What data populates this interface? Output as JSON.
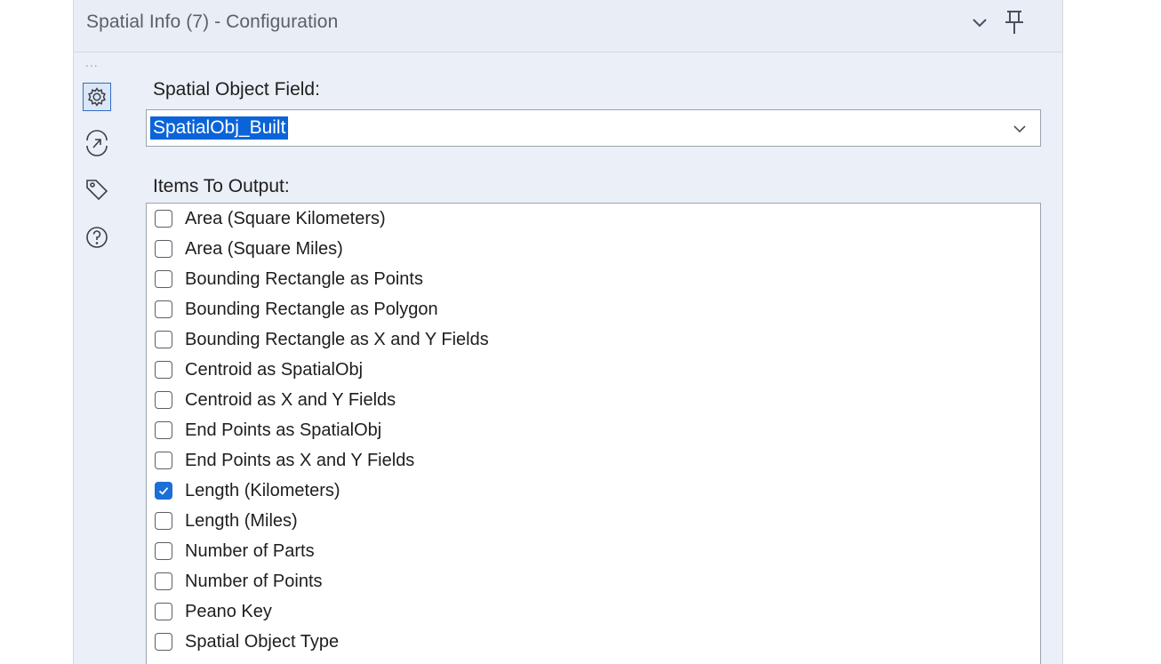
{
  "header": {
    "title": "Spatial Info (7) - Configuration",
    "collapse_icon": "chevron-down-icon",
    "pin_icon": "pin-icon"
  },
  "sidebar": {
    "more_glyph": "...",
    "items": [
      {
        "icon": "gear-icon",
        "active": true
      },
      {
        "icon": "connection-icon",
        "active": false
      },
      {
        "icon": "tag-icon",
        "active": false
      },
      {
        "icon": "help-icon",
        "active": false
      }
    ]
  },
  "spatial_field": {
    "label": "Spatial Object Field:",
    "selected": "SpatialObj_Built"
  },
  "items_output": {
    "label": "Items To Output:",
    "items": [
      {
        "label": "Area (Square Kilometers)",
        "checked": false
      },
      {
        "label": "Area (Square Miles)",
        "checked": false
      },
      {
        "label": "Bounding Rectangle as Points",
        "checked": false
      },
      {
        "label": "Bounding Rectangle as Polygon",
        "checked": false
      },
      {
        "label": "Bounding Rectangle as X and Y Fields",
        "checked": false
      },
      {
        "label": "Centroid as SpatialObj",
        "checked": false
      },
      {
        "label": "Centroid as X and Y Fields",
        "checked": false
      },
      {
        "label": "End Points as SpatialObj",
        "checked": false
      },
      {
        "label": "End Points as X and Y Fields",
        "checked": false
      },
      {
        "label": "Length (Kilometers)",
        "checked": true
      },
      {
        "label": "Length (Miles)",
        "checked": false
      },
      {
        "label": "Number of Parts",
        "checked": false
      },
      {
        "label": "Number of Points",
        "checked": false
      },
      {
        "label": "Peano Key",
        "checked": false
      },
      {
        "label": "Spatial Object Type",
        "checked": false
      }
    ]
  },
  "colors": {
    "panel_bg": "#ebeff7",
    "accent": "#1b6fd6",
    "selection": "#0a64d8"
  }
}
